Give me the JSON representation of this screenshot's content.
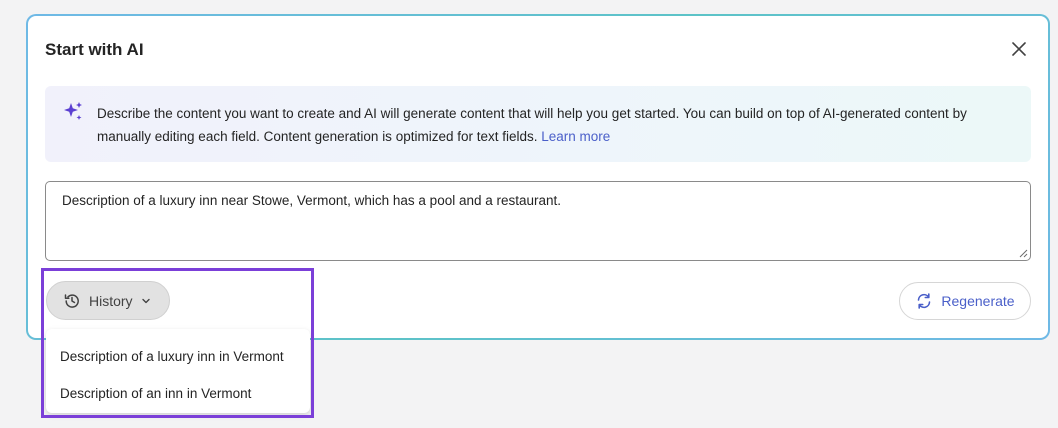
{
  "dialog": {
    "title": "Start with AI",
    "info": {
      "text": "Describe the content you want to create and AI will generate content that will help you get started. You can build on top of AI-generated content by manually editing each field. Content generation is optimized for text fields.",
      "link_label": "Learn more"
    },
    "prompt": {
      "value": "Description of a luxury inn near Stowe, Vermont, which has a pool and a restaurant."
    },
    "history_button_label": "History",
    "regenerate_button_label": "Regenerate",
    "history_items": [
      "Description of a luxury inn in Vermont",
      "Description of an inn in Vermont"
    ]
  },
  "colors": {
    "accent": "#4a5fc9",
    "highlight": "#7b3fd8",
    "border_gradient": "#5cc3c7"
  },
  "icons": [
    "close-icon",
    "sparkle-icon",
    "history-icon",
    "chevron-down-icon",
    "regenerate-icon"
  ]
}
